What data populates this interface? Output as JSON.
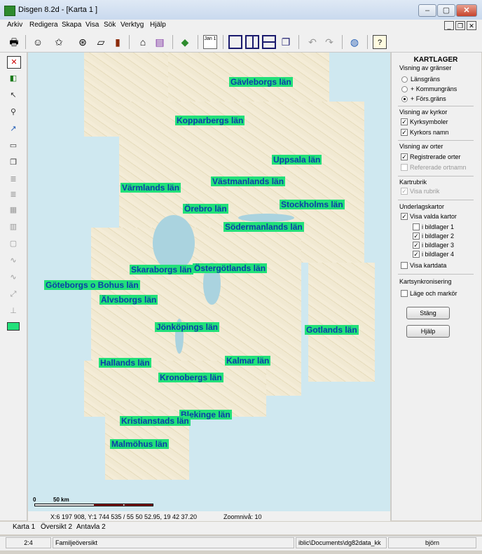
{
  "window": {
    "title": "Disgen 8.2d - [Karta 1 ]"
  },
  "menu": [
    "Arkiv",
    "Redigera",
    "Skapa",
    "Visa",
    "Sök",
    "Verktyg",
    "Hjälp"
  ],
  "toolbar": {
    "icons": [
      "printer-icon",
      "person-icon",
      "star-person-icon",
      "binoculars-icon",
      "open-folder-icon",
      "book-icon",
      "home-icon",
      "books-icon",
      "map-icon",
      "calendar-icon",
      "layout-single-icon",
      "layout-columns-icon",
      "layout-rows-icon",
      "layout-cascade-icon",
      "undo-icon",
      "redo-icon",
      "globe-icon",
      "help-icon"
    ],
    "calendar_label": "Jan 1"
  },
  "map": {
    "labels": [
      "Gävleborgs län",
      "Kopparbergs län",
      "Uppsala län",
      "Värmlands län",
      "Västmanlands län",
      "Örebro län",
      "Stockholms län",
      "Södermanlands län",
      "Skaraborgs län",
      "Östergötlands län",
      "Göteborgs o Bohus län",
      "Älvsborgs län",
      "Jönköpings län",
      "Gotlands län",
      "Hallands län",
      "Kalmar län",
      "Kronobergs län",
      "Blekinge län",
      "Kristianstads län",
      "Malmöhus län"
    ],
    "scale": {
      "zero": "0",
      "distance": "50 km"
    },
    "coordinates": "X:6 197 908, Y:1 744 535 / 55 50 52.95, 19 42 37.20",
    "zoom": "Zoomnivå: 10"
  },
  "panel": {
    "title": "KARTLAGER",
    "boundaries": {
      "label": "Visning av gränser",
      "options": [
        "Länsgräns",
        "+ Kommungräns",
        "+ Förs.gräns"
      ],
      "selected": 2
    },
    "churches": {
      "label": "Visning av kyrkor",
      "options": [
        {
          "label": "Kyrksymboler",
          "checked": true
        },
        {
          "label": "Kyrkors namn",
          "checked": true
        }
      ]
    },
    "places": {
      "label": "Visning av orter",
      "options": [
        {
          "label": "Registrerade orter",
          "checked": true
        },
        {
          "label": "Refererade ortnamn",
          "checked": false
        }
      ]
    },
    "heading": {
      "label": "Kartrubrik",
      "option": "Visa rubrik"
    },
    "base_maps": {
      "label": "Underlagskartor",
      "show_selected": "Visa valda kartor",
      "layers": [
        {
          "label": "i bildlager 1",
          "checked": false
        },
        {
          "label": "i bildlager 2",
          "checked": true
        },
        {
          "label": "i bildlager 3",
          "checked": true
        },
        {
          "label": "i bildlager 4",
          "checked": true
        }
      ],
      "show_data": "Visa kartdata"
    },
    "sync": {
      "label": "Kartsynkronisering",
      "option": "Läge och markör"
    },
    "close_button": "Stäng",
    "help_button": "Hjälp"
  },
  "tabs": [
    "Karta 1",
    "Översikt 2",
    "Antavla 2"
  ],
  "status": {
    "cell1": "2:4",
    "cell2": "Familjeöversikt",
    "cell3": "iblic\\Documents\\dg82data_kk",
    "cell4": "björn"
  }
}
